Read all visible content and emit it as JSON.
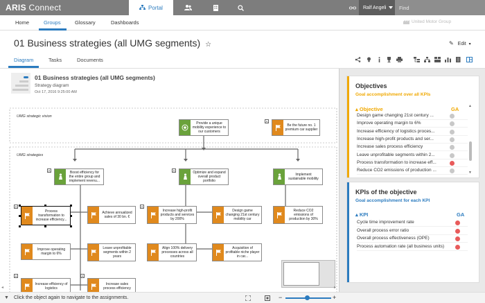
{
  "topbar": {
    "brand_main": "ARIS",
    "brand_sub": " Connect",
    "portal_label": "Portal",
    "user_name": "Ralf Angeli",
    "find_placeholder": "Find"
  },
  "subnav": {
    "items": [
      "Home",
      "Groups",
      "Glossary",
      "Dashboards"
    ],
    "company": "United Motor Group"
  },
  "page": {
    "title": "01 Business strategies (all UMG segments)",
    "edit_label": "Edit",
    "tabs": [
      "Diagram",
      "Tasks",
      "Documents"
    ]
  },
  "diagram_header": {
    "name": "01 Business strategies (all UMG segments)",
    "type": "Strategy diagram",
    "date": "Oct 17, 2016 9:25:00 AM"
  },
  "diagram": {
    "lane_vision": "UMG strategic vision",
    "lane_strategies": "UMG strategies",
    "nodes": [
      {
        "id": "n1",
        "text": "Provide a unique mobility experience to our customers"
      },
      {
        "id": "n2",
        "text": "Be the future no. 1 premium car supplier"
      },
      {
        "id": "n3",
        "text": "Boost efficiency for the entire group and implement revenu..."
      },
      {
        "id": "n4",
        "text": "Optimize and expand overall product portfolio"
      },
      {
        "id": "n5",
        "text": "Implement sustainable mobility"
      },
      {
        "id": "n6",
        "text": "Process transformation to increase efficiency..."
      },
      {
        "id": "n7",
        "text": "Achieve annualized sales of 30 bn. €"
      },
      {
        "id": "n8",
        "text": "Increase high-profit products and services by 200%"
      },
      {
        "id": "n9",
        "text": "Design game changing 21st century mobility car"
      },
      {
        "id": "n10",
        "text": "Reduce CO2 emissions of production by 30%"
      },
      {
        "id": "n11",
        "text": "Improve operating margin to 6%"
      },
      {
        "id": "n12",
        "text": "Leave unprofitable segments within 2 years"
      },
      {
        "id": "n13",
        "text": "Align 100% delivery processes across all countries"
      },
      {
        "id": "n14",
        "text": "Acquisition of profitable niche player in car..."
      },
      {
        "id": "n15",
        "text": "Increase efficiency of logistics"
      },
      {
        "id": "n16",
        "text": "Increase sales process efficiency"
      }
    ]
  },
  "objectives": {
    "title": "Objectives",
    "subtitle": "Goal accomplishment over all KPIs",
    "col_objective": "Objective",
    "col_ga": "GA",
    "rows": [
      {
        "label": "Design game changing 21st century ...",
        "status": "#c8c8c8"
      },
      {
        "label": "Improve operating margin to 6%",
        "status": "#c8c8c8"
      },
      {
        "label": "Increase efficiency of logistics proces...",
        "status": "#c8c8c8"
      },
      {
        "label": "Increase high-profit  products and ser...",
        "status": "#c8c8c8"
      },
      {
        "label": "Increase sales process efficiency",
        "status": "#c8c8c8"
      },
      {
        "label": "Leave unprofitable segments within 2...",
        "status": "#c8c8c8"
      },
      {
        "label": "Process transformation to increase eff...",
        "status": "#e85b5b"
      },
      {
        "label": "Reduce CO2 emissions of production ...",
        "status": "#c8c8c8"
      }
    ]
  },
  "kpis": {
    "title": "KPIs of the objective",
    "subtitle": "Goal accomplishment for each KPI",
    "col_kpi": "KPI",
    "col_ga": "GA",
    "rows": [
      {
        "label": "Cycle time  improvement rate",
        "status": "#e85b5b"
      },
      {
        "label": "Overall process  error ratio",
        "status": "#e85b5b"
      },
      {
        "label": "Overall process effectiveness (OPE)",
        "status": "#e85b5b"
      },
      {
        "label": "Process  automation rate (all business units)",
        "status": "#e85b5b"
      }
    ]
  },
  "status": {
    "text": "Click the object again to navigate to the assignments."
  },
  "colors": {
    "accent": "#2b7bbf",
    "orange": "#e0891d",
    "green": "#6aa23b",
    "red": "#e85b5b"
  }
}
